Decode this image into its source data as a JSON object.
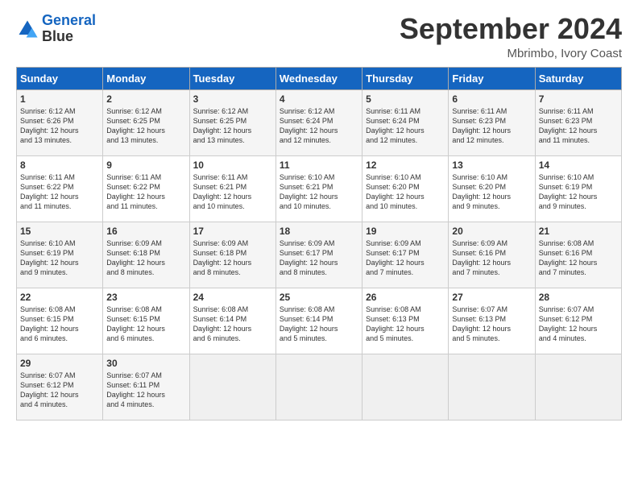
{
  "header": {
    "logo_line1": "General",
    "logo_line2": "Blue",
    "month": "September 2024",
    "location": "Mbrimbo, Ivory Coast"
  },
  "days_of_week": [
    "Sunday",
    "Monday",
    "Tuesday",
    "Wednesday",
    "Thursday",
    "Friday",
    "Saturday"
  ],
  "weeks": [
    [
      {
        "day": "1",
        "text": "Sunrise: 6:12 AM\nSunset: 6:26 PM\nDaylight: 12 hours\nand 13 minutes."
      },
      {
        "day": "2",
        "text": "Sunrise: 6:12 AM\nSunset: 6:25 PM\nDaylight: 12 hours\nand 13 minutes."
      },
      {
        "day": "3",
        "text": "Sunrise: 6:12 AM\nSunset: 6:25 PM\nDaylight: 12 hours\nand 13 minutes."
      },
      {
        "day": "4",
        "text": "Sunrise: 6:12 AM\nSunset: 6:24 PM\nDaylight: 12 hours\nand 12 minutes."
      },
      {
        "day": "5",
        "text": "Sunrise: 6:11 AM\nSunset: 6:24 PM\nDaylight: 12 hours\nand 12 minutes."
      },
      {
        "day": "6",
        "text": "Sunrise: 6:11 AM\nSunset: 6:23 PM\nDaylight: 12 hours\nand 12 minutes."
      },
      {
        "day": "7",
        "text": "Sunrise: 6:11 AM\nSunset: 6:23 PM\nDaylight: 12 hours\nand 11 minutes."
      }
    ],
    [
      {
        "day": "8",
        "text": "Sunrise: 6:11 AM\nSunset: 6:22 PM\nDaylight: 12 hours\nand 11 minutes."
      },
      {
        "day": "9",
        "text": "Sunrise: 6:11 AM\nSunset: 6:22 PM\nDaylight: 12 hours\nand 11 minutes."
      },
      {
        "day": "10",
        "text": "Sunrise: 6:11 AM\nSunset: 6:21 PM\nDaylight: 12 hours\nand 10 minutes."
      },
      {
        "day": "11",
        "text": "Sunrise: 6:10 AM\nSunset: 6:21 PM\nDaylight: 12 hours\nand 10 minutes."
      },
      {
        "day": "12",
        "text": "Sunrise: 6:10 AM\nSunset: 6:20 PM\nDaylight: 12 hours\nand 10 minutes."
      },
      {
        "day": "13",
        "text": "Sunrise: 6:10 AM\nSunset: 6:20 PM\nDaylight: 12 hours\nand 9 minutes."
      },
      {
        "day": "14",
        "text": "Sunrise: 6:10 AM\nSunset: 6:19 PM\nDaylight: 12 hours\nand 9 minutes."
      }
    ],
    [
      {
        "day": "15",
        "text": "Sunrise: 6:10 AM\nSunset: 6:19 PM\nDaylight: 12 hours\nand 9 minutes."
      },
      {
        "day": "16",
        "text": "Sunrise: 6:09 AM\nSunset: 6:18 PM\nDaylight: 12 hours\nand 8 minutes."
      },
      {
        "day": "17",
        "text": "Sunrise: 6:09 AM\nSunset: 6:18 PM\nDaylight: 12 hours\nand 8 minutes."
      },
      {
        "day": "18",
        "text": "Sunrise: 6:09 AM\nSunset: 6:17 PM\nDaylight: 12 hours\nand 8 minutes."
      },
      {
        "day": "19",
        "text": "Sunrise: 6:09 AM\nSunset: 6:17 PM\nDaylight: 12 hours\nand 7 minutes."
      },
      {
        "day": "20",
        "text": "Sunrise: 6:09 AM\nSunset: 6:16 PM\nDaylight: 12 hours\nand 7 minutes."
      },
      {
        "day": "21",
        "text": "Sunrise: 6:08 AM\nSunset: 6:16 PM\nDaylight: 12 hours\nand 7 minutes."
      }
    ],
    [
      {
        "day": "22",
        "text": "Sunrise: 6:08 AM\nSunset: 6:15 PM\nDaylight: 12 hours\nand 6 minutes."
      },
      {
        "day": "23",
        "text": "Sunrise: 6:08 AM\nSunset: 6:15 PM\nDaylight: 12 hours\nand 6 minutes."
      },
      {
        "day": "24",
        "text": "Sunrise: 6:08 AM\nSunset: 6:14 PM\nDaylight: 12 hours\nand 6 minutes."
      },
      {
        "day": "25",
        "text": "Sunrise: 6:08 AM\nSunset: 6:14 PM\nDaylight: 12 hours\nand 5 minutes."
      },
      {
        "day": "26",
        "text": "Sunrise: 6:08 AM\nSunset: 6:13 PM\nDaylight: 12 hours\nand 5 minutes."
      },
      {
        "day": "27",
        "text": "Sunrise: 6:07 AM\nSunset: 6:13 PM\nDaylight: 12 hours\nand 5 minutes."
      },
      {
        "day": "28",
        "text": "Sunrise: 6:07 AM\nSunset: 6:12 PM\nDaylight: 12 hours\nand 4 minutes."
      }
    ],
    [
      {
        "day": "29",
        "text": "Sunrise: 6:07 AM\nSunset: 6:12 PM\nDaylight: 12 hours\nand 4 minutes."
      },
      {
        "day": "30",
        "text": "Sunrise: 6:07 AM\nSunset: 6:11 PM\nDaylight: 12 hours\nand 4 minutes."
      },
      {
        "day": "",
        "text": ""
      },
      {
        "day": "",
        "text": ""
      },
      {
        "day": "",
        "text": ""
      },
      {
        "day": "",
        "text": ""
      },
      {
        "day": "",
        "text": ""
      }
    ]
  ]
}
